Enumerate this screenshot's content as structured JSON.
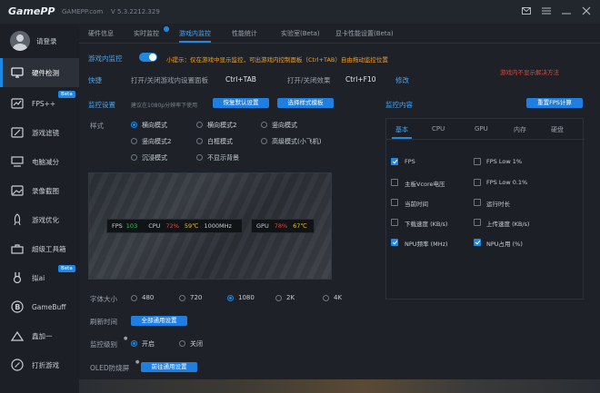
{
  "window": {
    "logo": "GamePP",
    "site": "GAMEPP.com",
    "version": "V 5.3.2212.329"
  },
  "user": {
    "name": "请登录"
  },
  "sidebar": {
    "items": [
      {
        "label": "硬件检测",
        "icon": "monitor-icon",
        "active": true
      },
      {
        "label": "FPS++",
        "icon": "fps-icon",
        "badge": "Beta"
      },
      {
        "label": "游戏滤镜",
        "icon": "filter-icon"
      },
      {
        "label": "电脑减分",
        "icon": "computer-icon"
      },
      {
        "label": "录像截图",
        "icon": "image-icon"
      },
      {
        "label": "游戏优化",
        "icon": "rocket-icon"
      },
      {
        "label": "超级工具箱",
        "icon": "toolbox-icon"
      },
      {
        "label": "拟ai",
        "icon": "rabbit-icon",
        "badge": "Beta"
      },
      {
        "label": "GameBuff",
        "icon": "gamebuff-icon"
      },
      {
        "label": "鑫加一",
        "icon": "plus-icon"
      },
      {
        "label": "打折游戏",
        "icon": "discount-icon"
      }
    ]
  },
  "tabs": [
    {
      "label": "硬件信息"
    },
    {
      "label": "实时监控"
    },
    {
      "label": "游戏内监控",
      "active": true
    },
    {
      "label": "性能统计"
    },
    {
      "label": "实验室(Beta)"
    },
    {
      "label": "显卡性能设置(Beta)"
    }
  ],
  "ingame": {
    "toggle_label": "游戏内监控",
    "tip": "小提示：仅在游戏中显示监控，可出游戏内控制面板（Ctrl+TAB）自由拖动监控位置",
    "shortcut_label": "快捷",
    "shortcut1_label": "打开/关闭游戏内设置面板",
    "shortcut1_key": "Ctrl+TAB",
    "shortcut2_label": "打开/关闭效果",
    "shortcut2_key": "Ctrl+F10",
    "modify": "修改",
    "right_warning": "游戏内不显示解决方法"
  },
  "settings": {
    "title": "监控设置",
    "hint": "建议在1080p分辨率下使用",
    "restore_btn": "恢复默认设置",
    "template_btn": "选择样式模板",
    "style_label": "样式",
    "styles": [
      {
        "label": "横向模式",
        "selected": true
      },
      {
        "label": "横向模式2"
      },
      {
        "label": "竖向模式"
      },
      {
        "label": "竖向模式2"
      },
      {
        "label": "白框模式"
      },
      {
        "label": "高级模式(小飞机)"
      },
      {
        "label": "沉浸模式"
      },
      {
        "label": "不显示背景"
      }
    ],
    "font_size_label": "字体大小",
    "font_sizes": [
      {
        "label": "480"
      },
      {
        "label": "720"
      },
      {
        "label": "1080",
        "selected": true
      },
      {
        "label": "2K"
      },
      {
        "label": "4K"
      }
    ],
    "refresh_label": "刷新时间",
    "refresh_btn": "全部通用设置",
    "monitor_level_label": "监控级别",
    "monitor_level": [
      {
        "label": "开启",
        "selected": true
      },
      {
        "label": "关闭"
      }
    ],
    "oled_label": "OLED防烧屏",
    "oled_btn": "前往通用设置"
  },
  "overlay": {
    "fps_label": "FPS",
    "fps_value": "103",
    "cpu_label": "CPU",
    "cpu_load": "72%",
    "cpu_temp": "59℃",
    "cpu_freq": "1000MHz",
    "gpu_label": "GPU",
    "gpu_load": "78%",
    "gpu_temp": "67℃"
  },
  "monitor_content": {
    "title": "监控内容",
    "reset_btn": "重置FPS计算",
    "tabs": [
      {
        "label": "基本",
        "active": true
      },
      {
        "label": "CPU"
      },
      {
        "label": "GPU"
      },
      {
        "label": "内存"
      },
      {
        "label": "硬盘"
      }
    ],
    "items": [
      {
        "label": "FPS",
        "checked": true
      },
      {
        "label": "FPS Low 1%",
        "checked": false
      },
      {
        "label": "主板Vcore电压",
        "checked": false
      },
      {
        "label": "FPS Low 0.1%",
        "checked": false
      },
      {
        "label": "当前时间",
        "checked": false
      },
      {
        "label": "运行时长",
        "checked": false
      },
      {
        "label": "下载速度 (KB/s)",
        "checked": false
      },
      {
        "label": "上传速度 (KB/s)",
        "checked": false
      },
      {
        "label": "NPU频率 (MHz)",
        "checked": true
      },
      {
        "label": "NPU占用 (%)",
        "checked": true
      }
    ]
  },
  "colors": {
    "accent": "#1f88e5",
    "tip": "#f0a030",
    "warning": "#e0453a",
    "fps_green": "#34c759",
    "cpu_red": "#e0453a",
    "temp_yellow": "#f0c020"
  }
}
